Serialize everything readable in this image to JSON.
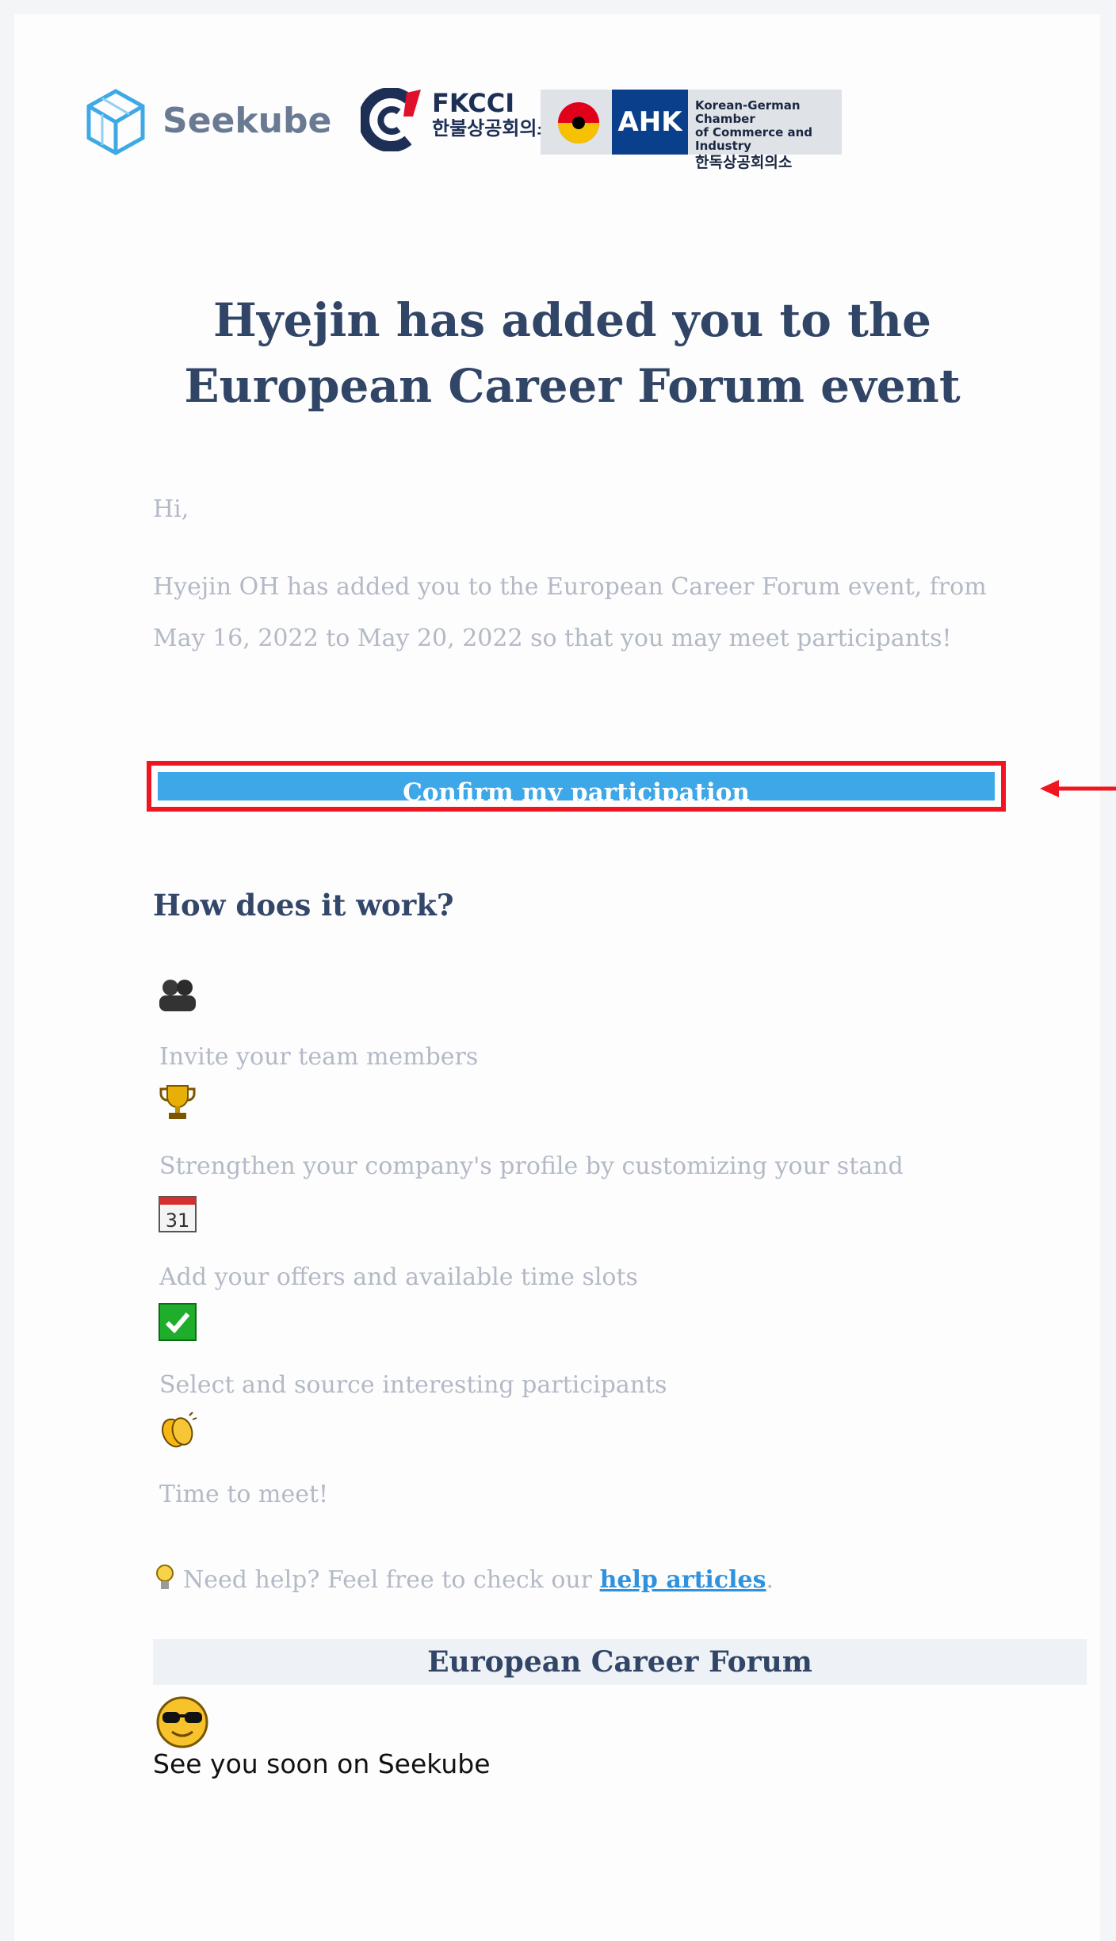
{
  "logos": {
    "seekube": "Seekube",
    "fkcci_name": "FKCCI",
    "fkcci_korean": "한불상공회의소",
    "ahk_name": "AHK",
    "ahk_line1": "Korean-German Chamber",
    "ahk_line2": "of Commerce and Industry",
    "ahk_korean": "한독상공회의소"
  },
  "headline": "Hyejin has added you to the European Career Forum event",
  "greeting": "Hi,",
  "intro": "Hyejin OH has added you to the European Career Forum event, from May 16, 2022 to May 20, 2022 so that you may meet participants!",
  "cta_label": "Confirm my participation",
  "how": {
    "title": "How does it work?",
    "steps": [
      {
        "icon": "team-icon",
        "label": "Invite your team members"
      },
      {
        "icon": "trophy-icon",
        "label": "Strengthen your company's profile by customizing your stand"
      },
      {
        "icon": "calendar-icon",
        "label": "Add your offers and available time slots"
      },
      {
        "icon": "checkmark-icon",
        "label": "Select and source interesting participants"
      },
      {
        "icon": "clapping-hands-icon",
        "label": "Time to meet!"
      }
    ]
  },
  "help": {
    "prefix": "Need help? Feel free to check our ",
    "link": "help articles",
    "suffix": "."
  },
  "event_name": "European Career Forum",
  "signoff": "See you soon on Seekube",
  "colors": {
    "button": "#3ea7e8",
    "highlight_box": "#ef1521",
    "heading": "#314567",
    "body_text": "#b3b9c5",
    "link": "#2e92df"
  }
}
